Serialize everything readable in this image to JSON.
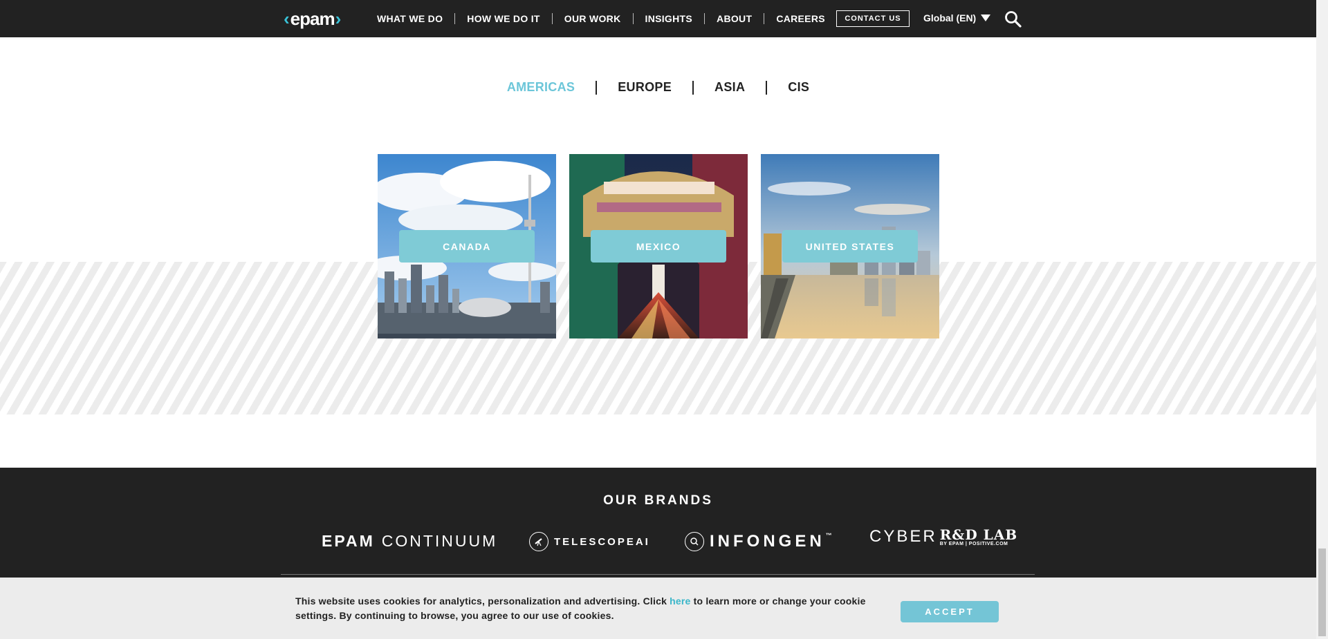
{
  "header": {
    "logo_text": "epam",
    "nav": [
      "WHAT WE DO",
      "HOW WE DO IT",
      "OUR WORK",
      "INSIGHTS",
      "ABOUT",
      "CAREERS"
    ],
    "contact_label": "CONTACT US",
    "language_label": "Global (EN)",
    "search_icon": "search-icon"
  },
  "regions": {
    "tabs": [
      "AMERICAS",
      "EUROPE",
      "ASIA",
      "CIS"
    ],
    "active": "AMERICAS"
  },
  "countries": [
    {
      "label": "CANADA"
    },
    {
      "label": "MEXICO"
    },
    {
      "label": "UNITED STATES"
    }
  ],
  "footer": {
    "brands_title": "OUR BRANDS",
    "brands": {
      "continuum_a": "EPAM",
      "continuum_b": "CONTINUUM",
      "telescope": "TELESCOPEAI",
      "infogen": "INFONGEN",
      "infogen_tm": "™",
      "cyber_a": "CYBER",
      "cyber_b": "R&D LAB",
      "cyber_sub": "BY EPAM | POSITIVE.COM"
    }
  },
  "cookie": {
    "text_before": "This website uses cookies for analytics, personalization and advertising. Click ",
    "link": "here",
    "text_after": " to learn more or change your cookie settings. By continuing to browse, you agree to our use of cookies.",
    "accept_label": "ACCEPT"
  },
  "colors": {
    "accent": "#39c2d7",
    "card_label": "#7fcbd6",
    "header_bg": "#222222"
  }
}
